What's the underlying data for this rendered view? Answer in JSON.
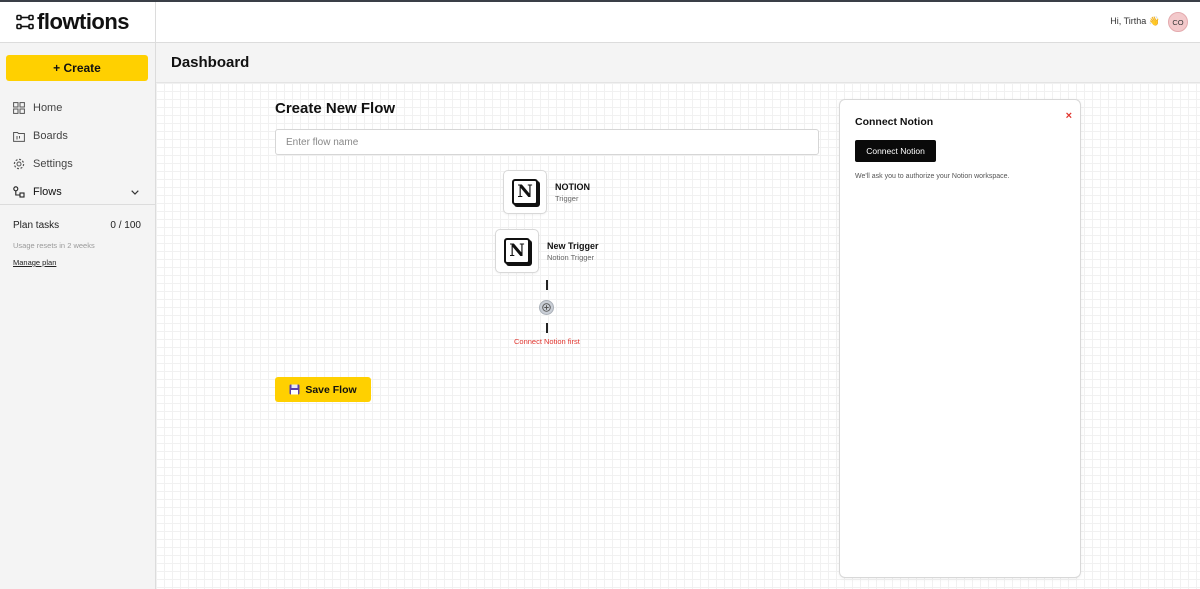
{
  "app": {
    "brand": "flowtions",
    "logo_icon": "flow-nodes-icon"
  },
  "sidebar": {
    "create_label": "+ Create",
    "items": [
      {
        "label": "Home",
        "icon": "grid-icon"
      },
      {
        "label": "Boards",
        "icon": "board-icon"
      },
      {
        "label": "Settings",
        "icon": "gear-icon"
      },
      {
        "label": "Flows",
        "icon": "flows-icon",
        "expanded": false
      }
    ],
    "plan": {
      "label": "Plan tasks",
      "count": "0 / 100",
      "reset_note": "Usage resets in 2 weeks",
      "manage_link": "Manage plan"
    }
  },
  "header": {
    "greeting": "Hi, Tirtha 👋",
    "avatar_initials": "CO",
    "page_title": "Dashboard"
  },
  "flow": {
    "title": "Create New Flow",
    "name_placeholder": "Enter flow name",
    "name_value": "",
    "app_node": {
      "name": "NOTION",
      "sub": "Trigger",
      "icon": "notion-icon"
    },
    "trigger_node": {
      "name": "New Trigger",
      "sub": "Notion Trigger",
      "icon": "notion-icon"
    },
    "warning": "Connect Notion first",
    "save_label": "Save Flow"
  },
  "panel": {
    "title": "Connect Notion",
    "close_symbol": "×",
    "button_label": "Connect Notion",
    "note": "We'll ask you to authorize your Notion workspace."
  },
  "colors": {
    "accent": "#ffd000",
    "error": "#e0342d",
    "avatar_bg": "#f3c9cb"
  }
}
